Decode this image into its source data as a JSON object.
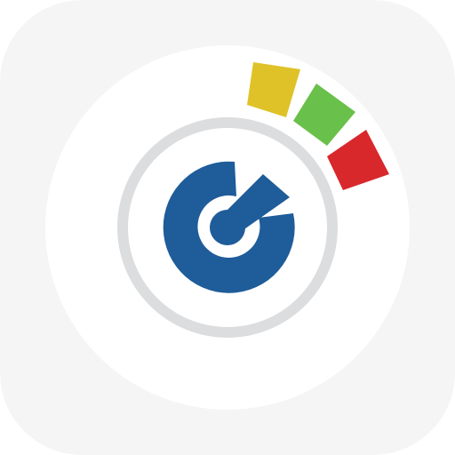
{
  "app_icon": {
    "icon_name": "gauge-target-icon",
    "colors": {
      "tile_background": "#f5f5f5",
      "inner_disc": "#ffffff",
      "ring": "#dcdddf",
      "blue": "#1f5c9a",
      "yellow": "#dfc227",
      "green": "#69c04a",
      "red": "#d8282c"
    },
    "segments": [
      "yellow",
      "green",
      "red"
    ]
  }
}
